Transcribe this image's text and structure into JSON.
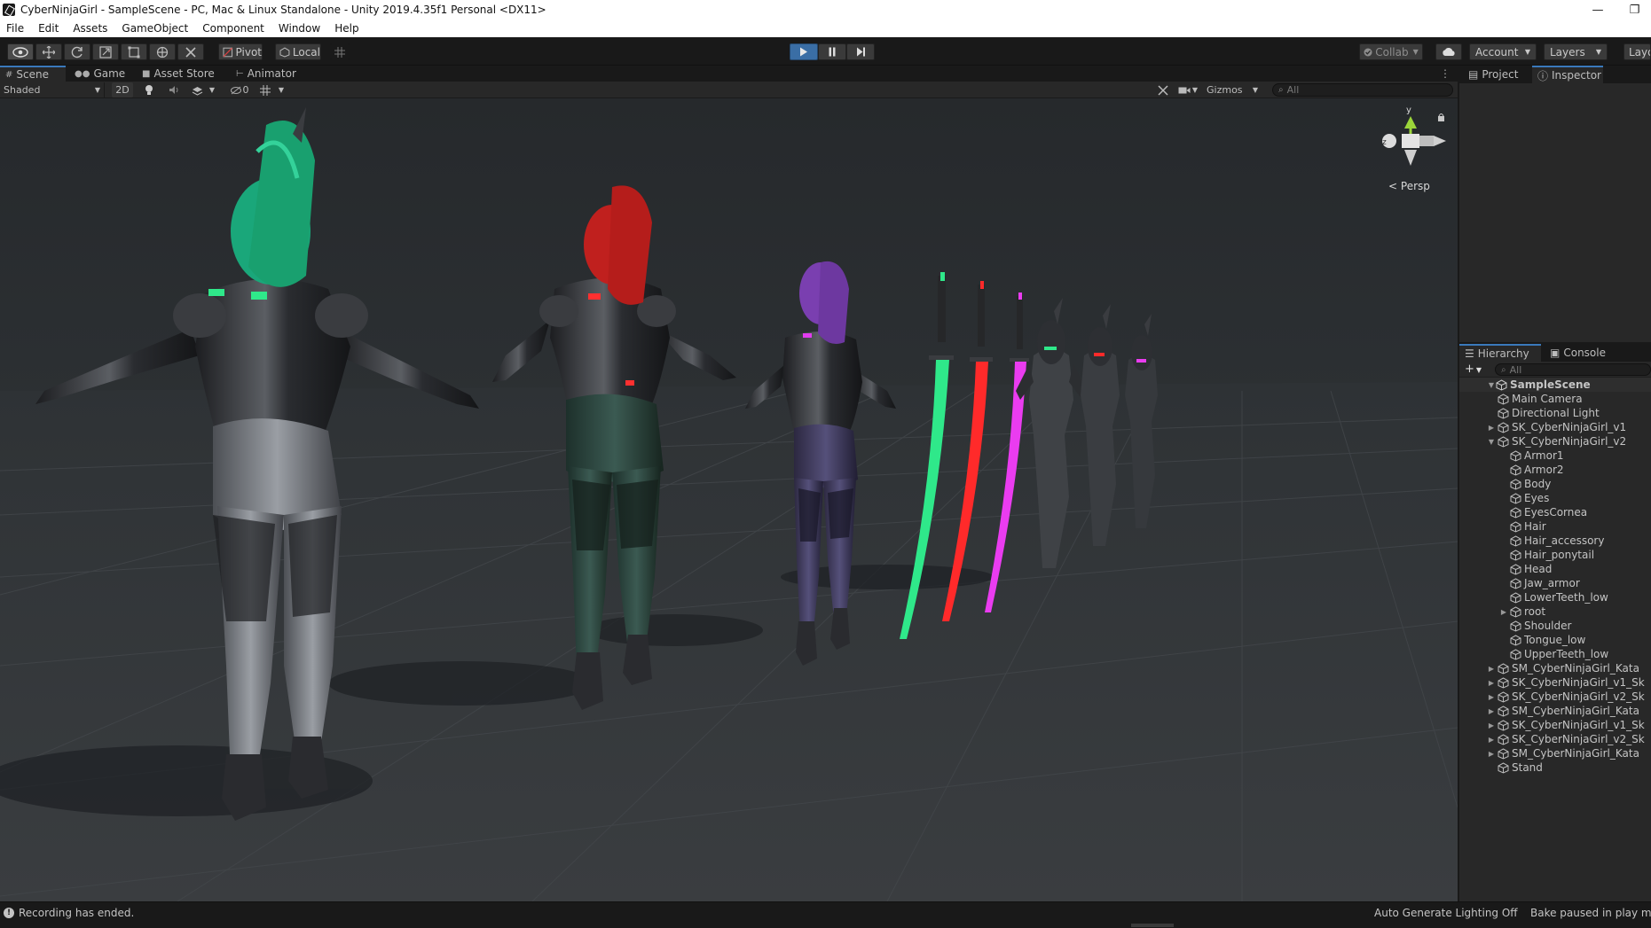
{
  "window": {
    "title": "CyberNinjaGirl - SampleScene - PC, Mac & Linux Standalone - Unity 2019.4.35f1 Personal <DX11>",
    "minimize_glyph": "—",
    "restore_glyph": "❐"
  },
  "menu": [
    "File",
    "Edit",
    "Assets",
    "GameObject",
    "Component",
    "Window",
    "Help"
  ],
  "toolbar": {
    "pivot_label": "Pivot",
    "local_label": "Local",
    "collab_label": "Collab",
    "account_label": "Account",
    "layers_label": "Layers",
    "layout_label": "Layo"
  },
  "dock_tabs": {
    "scene": "Scene",
    "game": "Game",
    "asset_store": "Asset Store",
    "animator": "Animator"
  },
  "scene_toolbar": {
    "shading_mode": "Shaded",
    "mode_2d": "2D",
    "hidden_count": "0",
    "gizmos_label": "Gizmos",
    "search_placeholder": "All"
  },
  "scene_view": {
    "projection_label": "Persp",
    "gizmo_axis_y": "y",
    "gizmo_axis_z": "z",
    "gizmo_axis_x": "x"
  },
  "right_tabs_top": {
    "project": "Project",
    "inspector": "Inspector"
  },
  "right_tabs_bottom": {
    "hierarchy": "Hierarchy",
    "console": "Console"
  },
  "hierarchy": {
    "search_placeholder": "All",
    "scene_name": "SampleScene",
    "items": [
      {
        "label": "Main Camera",
        "depth": 1,
        "arrow": ""
      },
      {
        "label": "Directional Light",
        "depth": 1,
        "arrow": ""
      },
      {
        "label": "SK_CyberNinjaGirl_v1",
        "depth": 1,
        "arrow": "▶"
      },
      {
        "label": "SK_CyberNinjaGirl_v2",
        "depth": 1,
        "arrow": "▼"
      },
      {
        "label": "Armor1",
        "depth": 2,
        "arrow": ""
      },
      {
        "label": "Armor2",
        "depth": 2,
        "arrow": ""
      },
      {
        "label": "Body",
        "depth": 2,
        "arrow": ""
      },
      {
        "label": "Eyes",
        "depth": 2,
        "arrow": ""
      },
      {
        "label": "EyesCornea",
        "depth": 2,
        "arrow": ""
      },
      {
        "label": "Hair",
        "depth": 2,
        "arrow": ""
      },
      {
        "label": "Hair_accessory",
        "depth": 2,
        "arrow": ""
      },
      {
        "label": "Hair_ponytail",
        "depth": 2,
        "arrow": ""
      },
      {
        "label": "Head",
        "depth": 2,
        "arrow": ""
      },
      {
        "label": "Jaw_armor",
        "depth": 2,
        "arrow": ""
      },
      {
        "label": "LowerTeeth_low",
        "depth": 2,
        "arrow": ""
      },
      {
        "label": "root",
        "depth": 2,
        "arrow": "▶"
      },
      {
        "label": "Shoulder",
        "depth": 2,
        "arrow": ""
      },
      {
        "label": "Tongue_low",
        "depth": 2,
        "arrow": ""
      },
      {
        "label": "UpperTeeth_low",
        "depth": 2,
        "arrow": ""
      },
      {
        "label": "SM_CyberNinjaGirl_Kata",
        "depth": 1,
        "arrow": "▶"
      },
      {
        "label": "SK_CyberNinjaGirl_v1_Sk",
        "depth": 1,
        "arrow": "▶"
      },
      {
        "label": "SK_CyberNinjaGirl_v2_Sk",
        "depth": 1,
        "arrow": "▶"
      },
      {
        "label": "SM_CyberNinjaGirl_Kata",
        "depth": 1,
        "arrow": "▶"
      },
      {
        "label": "SK_CyberNinjaGirl_v1_Sk",
        "depth": 1,
        "arrow": "▶"
      },
      {
        "label": "SK_CyberNinjaGirl_v2_Sk",
        "depth": 1,
        "arrow": "▶"
      },
      {
        "label": "SM_CyberNinjaGirl_Kata",
        "depth": 1,
        "arrow": "▶"
      },
      {
        "label": "Stand",
        "depth": 1,
        "arrow": ""
      }
    ]
  },
  "status": {
    "message": "Recording has ended.",
    "lighting": "Auto Generate Lighting Off",
    "bake": "Bake paused in play mo"
  },
  "colors": {
    "accent_blue": "#3a79bb",
    "play_active": "#3a6ea5",
    "hair_green": "#1aa77a",
    "hair_red": "#c0201e",
    "hair_purple": "#7a3fb0",
    "blade_green": "#2fe88a",
    "blade_red": "#ff2a2a",
    "blade_magenta": "#ea3cf0"
  }
}
